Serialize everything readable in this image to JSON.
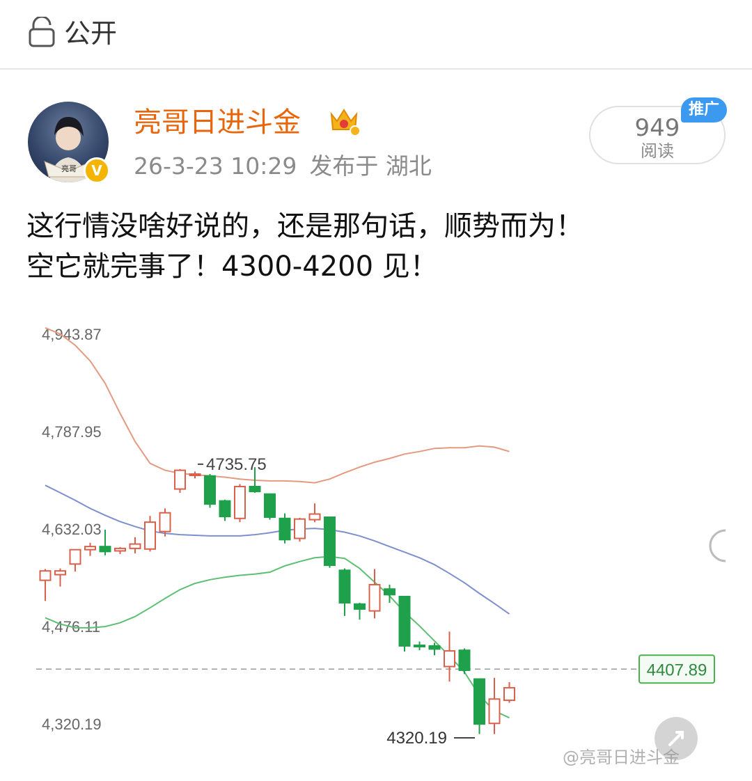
{
  "header": {
    "visibility_label": "公开",
    "icon": "lock-icon"
  },
  "post": {
    "author": "亮哥日进斗金",
    "datetime": "26-3-23 10:29",
    "location": "发布于 湖北",
    "avatar_text": "亮哥",
    "reads": {
      "count": "949",
      "label": "阅读"
    },
    "promo_tag": "推广",
    "text_lines": [
      "这行情没啥好说的，还是那句话，顺势而为！",
      "空它就完事了！4300-4200 见！"
    ],
    "colors": {
      "author": "#e8650b",
      "promo": "#3b9af0",
      "verified": "#f5b400"
    }
  },
  "chart_data": {
    "type": "candlestick",
    "y_tick_labels": [
      "4,943.87",
      "4,787.95",
      "4,632.03",
      "4,476.11",
      "4,320.19"
    ],
    "y_ticks": [
      4943.87,
      4787.95,
      4632.03,
      4476.11,
      4320.19
    ],
    "annotations": {
      "high_label": "4735.75",
      "low_label": "4320.19",
      "current_price_label": "4407.89"
    },
    "current_price": 4407.89,
    "indicator": "bollinger",
    "candles": [
      {
        "o": 4550,
        "h": 4568,
        "l": 4517,
        "c": 4565
      },
      {
        "o": 4559,
        "h": 4569,
        "l": 4540,
        "c": 4565
      },
      {
        "o": 4576,
        "h": 4596,
        "l": 4564,
        "c": 4599
      },
      {
        "o": 4599,
        "h": 4610,
        "l": 4589,
        "c": 4604
      },
      {
        "o": 4604,
        "h": 4631,
        "l": 4590,
        "c": 4596
      },
      {
        "o": 4597,
        "h": 4603,
        "l": 4592,
        "c": 4601
      },
      {
        "o": 4601,
        "h": 4619,
        "l": 4593,
        "c": 4608
      },
      {
        "o": 4600,
        "h": 4653,
        "l": 4596,
        "c": 4643
      },
      {
        "o": 4628,
        "h": 4665,
        "l": 4620,
        "c": 4658
      },
      {
        "o": 4696,
        "h": 4728,
        "l": 4690,
        "c": 4726
      },
      {
        "o": 4719,
        "h": 4724,
        "l": 4713,
        "c": 4720
      },
      {
        "o": 4717,
        "h": 4720,
        "l": 4666,
        "c": 4672
      },
      {
        "o": 4677,
        "h": 4679,
        "l": 4645,
        "c": 4652
      },
      {
        "o": 4649,
        "h": 4704,
        "l": 4643,
        "c": 4700
      },
      {
        "o": 4700,
        "h": 4731,
        "l": 4690,
        "c": 4692
      },
      {
        "o": 4688,
        "h": 4688,
        "l": 4647,
        "c": 4651
      },
      {
        "o": 4649,
        "h": 4657,
        "l": 4609,
        "c": 4615
      },
      {
        "o": 4617,
        "h": 4650,
        "l": 4612,
        "c": 4648
      },
      {
        "o": 4647,
        "h": 4673,
        "l": 4643,
        "c": 4656
      },
      {
        "o": 4651,
        "h": 4651,
        "l": 4570,
        "c": 4574
      },
      {
        "o": 4566,
        "h": 4569,
        "l": 4493,
        "c": 4514
      },
      {
        "o": 4512,
        "h": 4514,
        "l": 4487,
        "c": 4504
      },
      {
        "o": 4501,
        "h": 4568,
        "l": 4489,
        "c": 4543
      },
      {
        "o": 4536,
        "h": 4543,
        "l": 4514,
        "c": 4527
      },
      {
        "o": 4524,
        "h": 4524,
        "l": 4436,
        "c": 4445
      },
      {
        "o": 4446,
        "h": 4452,
        "l": 4438,
        "c": 4444
      },
      {
        "o": 4445,
        "h": 4450,
        "l": 4430,
        "c": 4440
      },
      {
        "o": 4412,
        "h": 4468,
        "l": 4388,
        "c": 4437
      },
      {
        "o": 4438,
        "h": 4441,
        "l": 4400,
        "c": 4406
      },
      {
        "o": 4392,
        "h": 4392,
        "l": 4304,
        "c": 4320
      },
      {
        "o": 4321,
        "h": 4394,
        "l": 4304,
        "c": 4360
      },
      {
        "o": 4358,
        "h": 4387,
        "l": 4354,
        "c": 4378
      }
    ],
    "bollinger_upper": [
      [
        0,
        4954
      ],
      [
        1,
        4944
      ],
      [
        2,
        4926
      ],
      [
        3,
        4901
      ],
      [
        4,
        4865
      ],
      [
        5,
        4817
      ],
      [
        6,
        4772
      ],
      [
        7,
        4737
      ],
      [
        8,
        4726
      ],
      [
        9,
        4721
      ],
      [
        10,
        4719
      ],
      [
        11,
        4717
      ],
      [
        12,
        4715
      ],
      [
        13,
        4712
      ],
      [
        14,
        4710
      ],
      [
        15,
        4709
      ],
      [
        16,
        4709
      ],
      [
        17,
        4708
      ],
      [
        18,
        4706
      ],
      [
        19,
        4712
      ],
      [
        20,
        4722
      ],
      [
        21,
        4731
      ],
      [
        22,
        4739
      ],
      [
        23,
        4745
      ],
      [
        24,
        4752
      ],
      [
        25,
        4756
      ],
      [
        26,
        4761
      ],
      [
        27,
        4762
      ],
      [
        28,
        4762
      ],
      [
        29,
        4765
      ],
      [
        30,
        4763
      ],
      [
        31,
        4756
      ]
    ],
    "bollinger_mid": [
      [
        0,
        4702
      ],
      [
        1,
        4690
      ],
      [
        2,
        4678
      ],
      [
        3,
        4665
      ],
      [
        4,
        4654
      ],
      [
        5,
        4644
      ],
      [
        6,
        4636
      ],
      [
        7,
        4629
      ],
      [
        8,
        4625
      ],
      [
        9,
        4623
      ],
      [
        10,
        4622
      ],
      [
        11,
        4621
      ],
      [
        12,
        4621
      ],
      [
        13,
        4621
      ],
      [
        14,
        4623
      ],
      [
        15,
        4626
      ],
      [
        16,
        4630
      ],
      [
        17,
        4632
      ],
      [
        18,
        4633
      ],
      [
        19,
        4631
      ],
      [
        20,
        4627
      ],
      [
        21,
        4621
      ],
      [
        22,
        4613
      ],
      [
        23,
        4604
      ],
      [
        24,
        4595
      ],
      [
        25,
        4586
      ],
      [
        26,
        4575
      ],
      [
        27,
        4561
      ],
      [
        28,
        4546
      ],
      [
        29,
        4529
      ],
      [
        30,
        4513
      ],
      [
        31,
        4496
      ]
    ],
    "bollinger_lower": [
      [
        0,
        4490
      ],
      [
        1,
        4480
      ],
      [
        2,
        4474
      ],
      [
        3,
        4474
      ],
      [
        4,
        4476
      ],
      [
        5,
        4482
      ],
      [
        6,
        4492
      ],
      [
        7,
        4506
      ],
      [
        8,
        4521
      ],
      [
        9,
        4535
      ],
      [
        10,
        4545
      ],
      [
        11,
        4551
      ],
      [
        12,
        4555
      ],
      [
        13,
        4558
      ],
      [
        14,
        4560
      ],
      [
        15,
        4563
      ],
      [
        16,
        4573
      ],
      [
        17,
        4580
      ],
      [
        18,
        4586
      ],
      [
        19,
        4588
      ],
      [
        20,
        4585
      ],
      [
        21,
        4569
      ],
      [
        22,
        4547
      ],
      [
        23,
        4525
      ],
      [
        24,
        4499
      ],
      [
        25,
        4477
      ],
      [
        26,
        4453
      ],
      [
        27,
        4429
      ],
      [
        28,
        4403
      ],
      [
        29,
        4366
      ],
      [
        30,
        4341
      ],
      [
        31,
        4330
      ]
    ],
    "colors": {
      "up": "#d9604a",
      "down": "#1fa04a",
      "upper_band": "#e49a80",
      "mid_band": "#7d8fcf",
      "lower_band": "#5cbf72",
      "price_tag": "#4caf50"
    },
    "grid": false
  },
  "footer": {
    "watermark": "@亮哥日进斗金"
  }
}
